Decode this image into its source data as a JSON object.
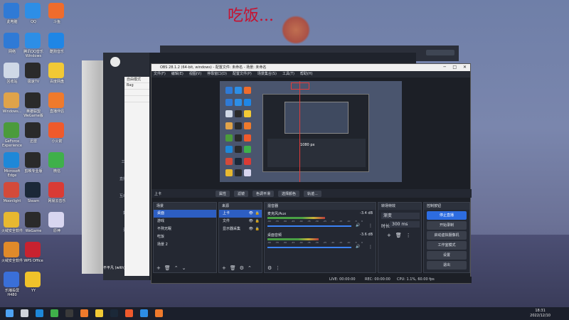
{
  "overlay": {
    "text": "吃饭..."
  },
  "desktop_left": [
    {
      "label": "此电脑",
      "color": "#2f7ad6"
    },
    {
      "label": "网络",
      "color": "#2f7ad6"
    },
    {
      "label": "回收站",
      "color": "#cfd8e6"
    },
    {
      "label": "Windows...",
      "color": "#e0a34a"
    },
    {
      "label": "GeForce Experience",
      "color": "#4b9b3b"
    },
    {
      "label": "Microsoft Edge",
      "color": "#1e88d8"
    },
    {
      "label": "Moonlight",
      "color": "#d34a3a"
    },
    {
      "label": "火绒安全软件",
      "color": "#e7b830"
    },
    {
      "label": "火绒安全软件",
      "color": "#e08a2a"
    },
    {
      "label": "乐播投屏 H480",
      "color": "#3a6fd8"
    }
  ],
  "desktop_col2": [
    {
      "label": "QQ",
      "color": "#2d8ee6"
    },
    {
      "label": "腾讯QQ音乐 Windows",
      "color": "#2d8ee6"
    },
    {
      "label": "极速TV",
      "color": "#2a2a2a"
    },
    {
      "label": "英雄联盟 WeGame版",
      "color": "#2a2a2a"
    },
    {
      "label": "迅雷",
      "color": "#2a2a2a"
    },
    {
      "label": "剪映专业版",
      "color": "#2a2a2a"
    },
    {
      "label": "Steam",
      "color": "#1b2838"
    },
    {
      "label": "WeGame",
      "color": "#2a2a2a"
    },
    {
      "label": "WPS Office",
      "color": "#c8222f"
    },
    {
      "label": "YY",
      "color": "#f0c22a"
    }
  ],
  "desktop_col3": [
    {
      "label": "斗鱼",
      "color": "#ef6c2c"
    },
    {
      "label": "酷狗音乐",
      "color": "#1f86e6"
    },
    {
      "label": "百度网盘",
      "color": "#f2c935"
    },
    {
      "label": "直播伴侣",
      "color": "#ef7a2c"
    },
    {
      "label": "小火箭",
      "color": "#ef5a2c"
    },
    {
      "label": "微信",
      "color": "#3fb04a"
    },
    {
      "label": "网易云音乐",
      "color": "#d93b35"
    },
    {
      "label": "原神",
      "color": "#d8d6f0"
    }
  ],
  "livehelper": {
    "side_items": [
      "工具箱",
      "直播伴侣",
      "互动玩法",
      "数据",
      "更多"
    ],
    "panel_rows": [
      "自由模式",
      "Bag",
      "",
      ""
    ],
    "bottom_tag": "不平凡 (with)"
  },
  "obs": {
    "title": "OBS 28.1.2 (64-bit, windows) - 配置文件: 未命名 - 场景: 未命名",
    "menu": [
      "文件(F)",
      "编辑(E)",
      "视图(V)",
      "停靠窗口(D)",
      "配置文件(P)",
      "场景集合(S)",
      "工具(T)",
      "帮助(H)"
    ],
    "preview_label": "1080 px",
    "source_bar": {
      "current_source": "上卡",
      "buttons": [
        "属性",
        "滤镜",
        "色调平滑",
        "选择颜色",
        "轨迹..."
      ]
    },
    "scenes": {
      "header": "场景",
      "items": [
        "桌面",
        "游戏",
        "不熬无眠",
        "吃饭",
        "场景 2"
      ],
      "selected": 0
    },
    "sources": {
      "header": "来源",
      "items": [
        "上卡",
        "文件",
        "显示器采集"
      ],
      "selected": 0
    },
    "mixer": {
      "header": "混音器",
      "tracks": [
        {
          "name": "麦克风/Aux",
          "db": "-3.4 dB",
          "level": 0.62
        },
        {
          "name": "桌面音频",
          "db": "-3.6 dB",
          "level": 0.55
        }
      ],
      "scale": [
        "-60",
        "-55",
        "-50",
        "-45",
        "-40",
        "-35",
        "-30",
        "-25",
        "-20",
        "-15",
        "-10",
        "-5",
        "0"
      ]
    },
    "transitions": {
      "header": "转场特效",
      "type": "渐变",
      "duration_label": "时长",
      "duration": "300 ms"
    },
    "controls": {
      "header": "控制按钮",
      "buttons": [
        "停止直播",
        "开始录制",
        "启动虚拟摄像机",
        "工作室模式",
        "设置",
        "退出"
      ]
    },
    "status": {
      "live": "LIVE: 00:00:00",
      "rec": "REC: 00:00:00",
      "cpu": "CPU: 1.1%, 60.00 fps"
    }
  },
  "taskbar": {
    "icons": [
      {
        "name": "start",
        "color": "#4ea3f2"
      },
      {
        "name": "search",
        "color": "#cfd3da"
      },
      {
        "name": "edge",
        "color": "#1e88d8"
      },
      {
        "name": "wechat",
        "color": "#3fb04a"
      },
      {
        "name": "obs",
        "color": "#3a3a3a"
      },
      {
        "name": "app",
        "color": "#ef7a2c"
      },
      {
        "name": "app2",
        "color": "#f2c935"
      },
      {
        "name": "steam",
        "color": "#1b2838"
      },
      {
        "name": "app3",
        "color": "#ef5a2c"
      },
      {
        "name": "app4",
        "color": "#2d8ee6"
      },
      {
        "name": "app5",
        "color": "#ef7a2c"
      }
    ],
    "time": "18:31",
    "date": "2022/12/10"
  }
}
